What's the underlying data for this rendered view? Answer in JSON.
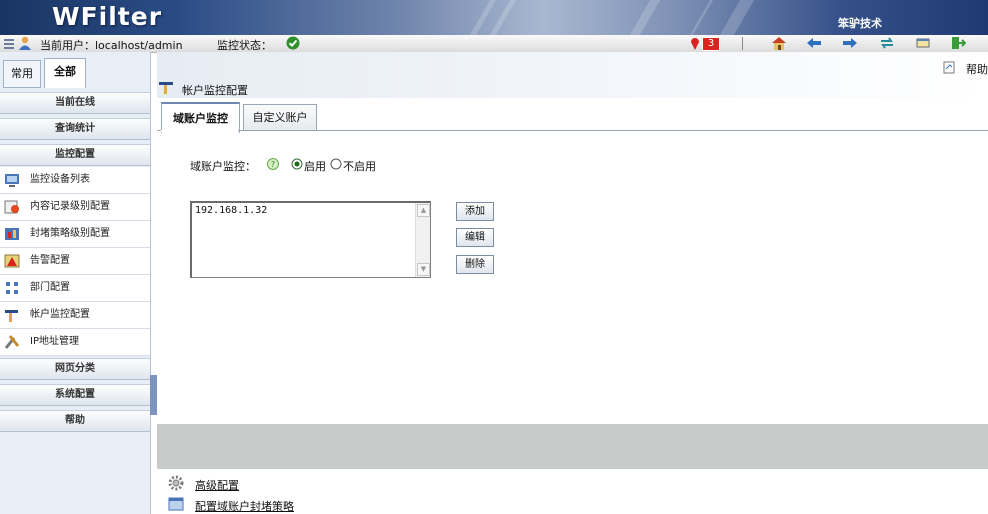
{
  "header": {
    "logo_text": "WFilter",
    "brand_text": "笨驴技术"
  },
  "toolbar": {
    "current_user_label": "当前用户：localhost/admin",
    "monitor_status_label": "监控状态：",
    "status_ok_icon": "check-circle-icon",
    "alert_count": "3",
    "icons": [
      "alert-pin-icon",
      "home-icon",
      "back-arrow-icon",
      "forward-arrow-icon",
      "refresh-icon",
      "window-icon",
      "exit-icon"
    ]
  },
  "sidebar": {
    "tabs": [
      {
        "label": "常用",
        "active": false
      },
      {
        "label": "全部",
        "active": true
      }
    ],
    "sections_top": [
      {
        "label": "当前在线"
      },
      {
        "label": "查询统计"
      },
      {
        "label": "监控配置"
      }
    ],
    "items": [
      {
        "label": "监控设备列表",
        "icon": "monitor-device-icon"
      },
      {
        "label": "内容记录级别配置",
        "icon": "content-record-icon"
      },
      {
        "label": "封堵策略级别配置",
        "icon": "block-policy-icon"
      },
      {
        "label": "告警配置",
        "icon": "alarm-icon"
      },
      {
        "label": "部门配置",
        "icon": "department-icon"
      },
      {
        "label": "帐户监控配置",
        "icon": "account-monitor-icon"
      },
      {
        "label": "IP地址管理",
        "icon": "ip-tools-icon"
      }
    ],
    "sections_bottom": [
      {
        "label": "网页分类"
      },
      {
        "label": "系统配置"
      },
      {
        "label": "帮助"
      }
    ]
  },
  "main": {
    "page_title": "帐户监控配置",
    "help_label": "帮助",
    "tabs": [
      {
        "label": "域账户监控",
        "active": true
      },
      {
        "label": "自定义账户",
        "active": false
      }
    ],
    "domain_monitor_label": "域账户监控：",
    "radio_enable": "启用",
    "radio_disable": "不启用",
    "enabled": true,
    "ip_list": [
      "192.168.1.32"
    ],
    "buttons": {
      "add": "添加",
      "edit": "编辑",
      "delete": "删除"
    },
    "links": [
      {
        "label": "高级配置",
        "icon": "gear-icon"
      },
      {
        "label": "配置域账户封堵策略",
        "icon": "window-icon"
      }
    ]
  },
  "colors": {
    "accent_blue": "#2a4c86",
    "sidebar_bg": "#e8eef6",
    "gray_band": "#c7cbc9"
  }
}
